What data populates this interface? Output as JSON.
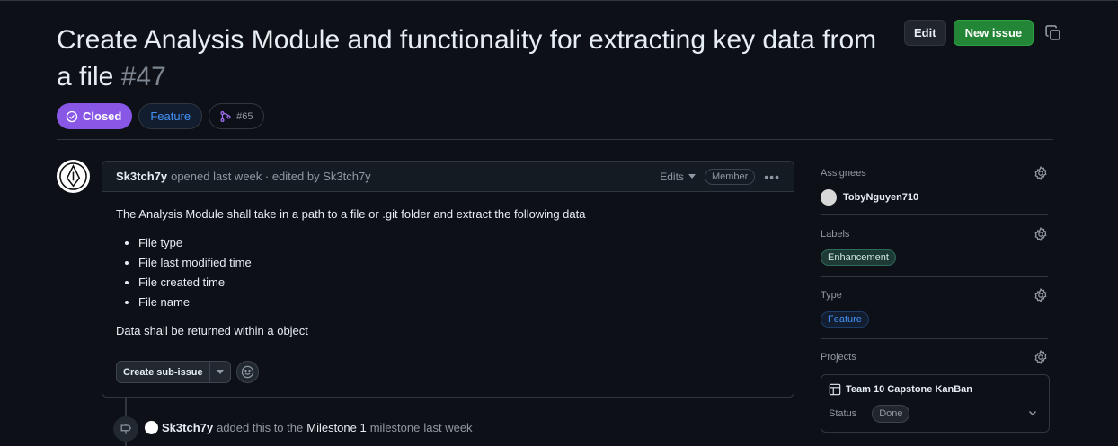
{
  "issue": {
    "title": "Create Analysis Module and functionality for extracting key data from a file",
    "number": "#47",
    "state": "Closed",
    "type_pill": "Feature",
    "linked_pr": "#65"
  },
  "header": {
    "edit_label": "Edit",
    "new_issue_label": "New issue"
  },
  "comment": {
    "author": "Sk3tch7y",
    "meta": "opened last week · edited by Sk3tch7y",
    "edits_label": "Edits",
    "role_badge": "Member",
    "intro": "The Analysis Module shall take in a path to a file or .git folder and extract the following data",
    "items": [
      "File type",
      "File last modified time",
      "File created time",
      "File name"
    ],
    "outro": "Data shall be returned within a object",
    "sub_issue_label": "Create sub-issue"
  },
  "timeline": {
    "actor": "Sk3tch7y",
    "action": "added this to the",
    "milestone": "Milestone 1",
    "suffix": "milestone",
    "when": "last week"
  },
  "sidebar": {
    "assignees_label": "Assignees",
    "assignee": "TobyNguyen710",
    "labels_label": "Labels",
    "label": "Enhancement",
    "type_label": "Type",
    "type_value": "Feature",
    "projects_label": "Projects",
    "project_name": "Team 10 Capstone KanBan",
    "status_label": "Status",
    "status_value": "Done"
  },
  "colors": {
    "background": "#0d1117",
    "closed": "#8957e5",
    "new_issue": "#238636",
    "feature": "#4493f8"
  }
}
